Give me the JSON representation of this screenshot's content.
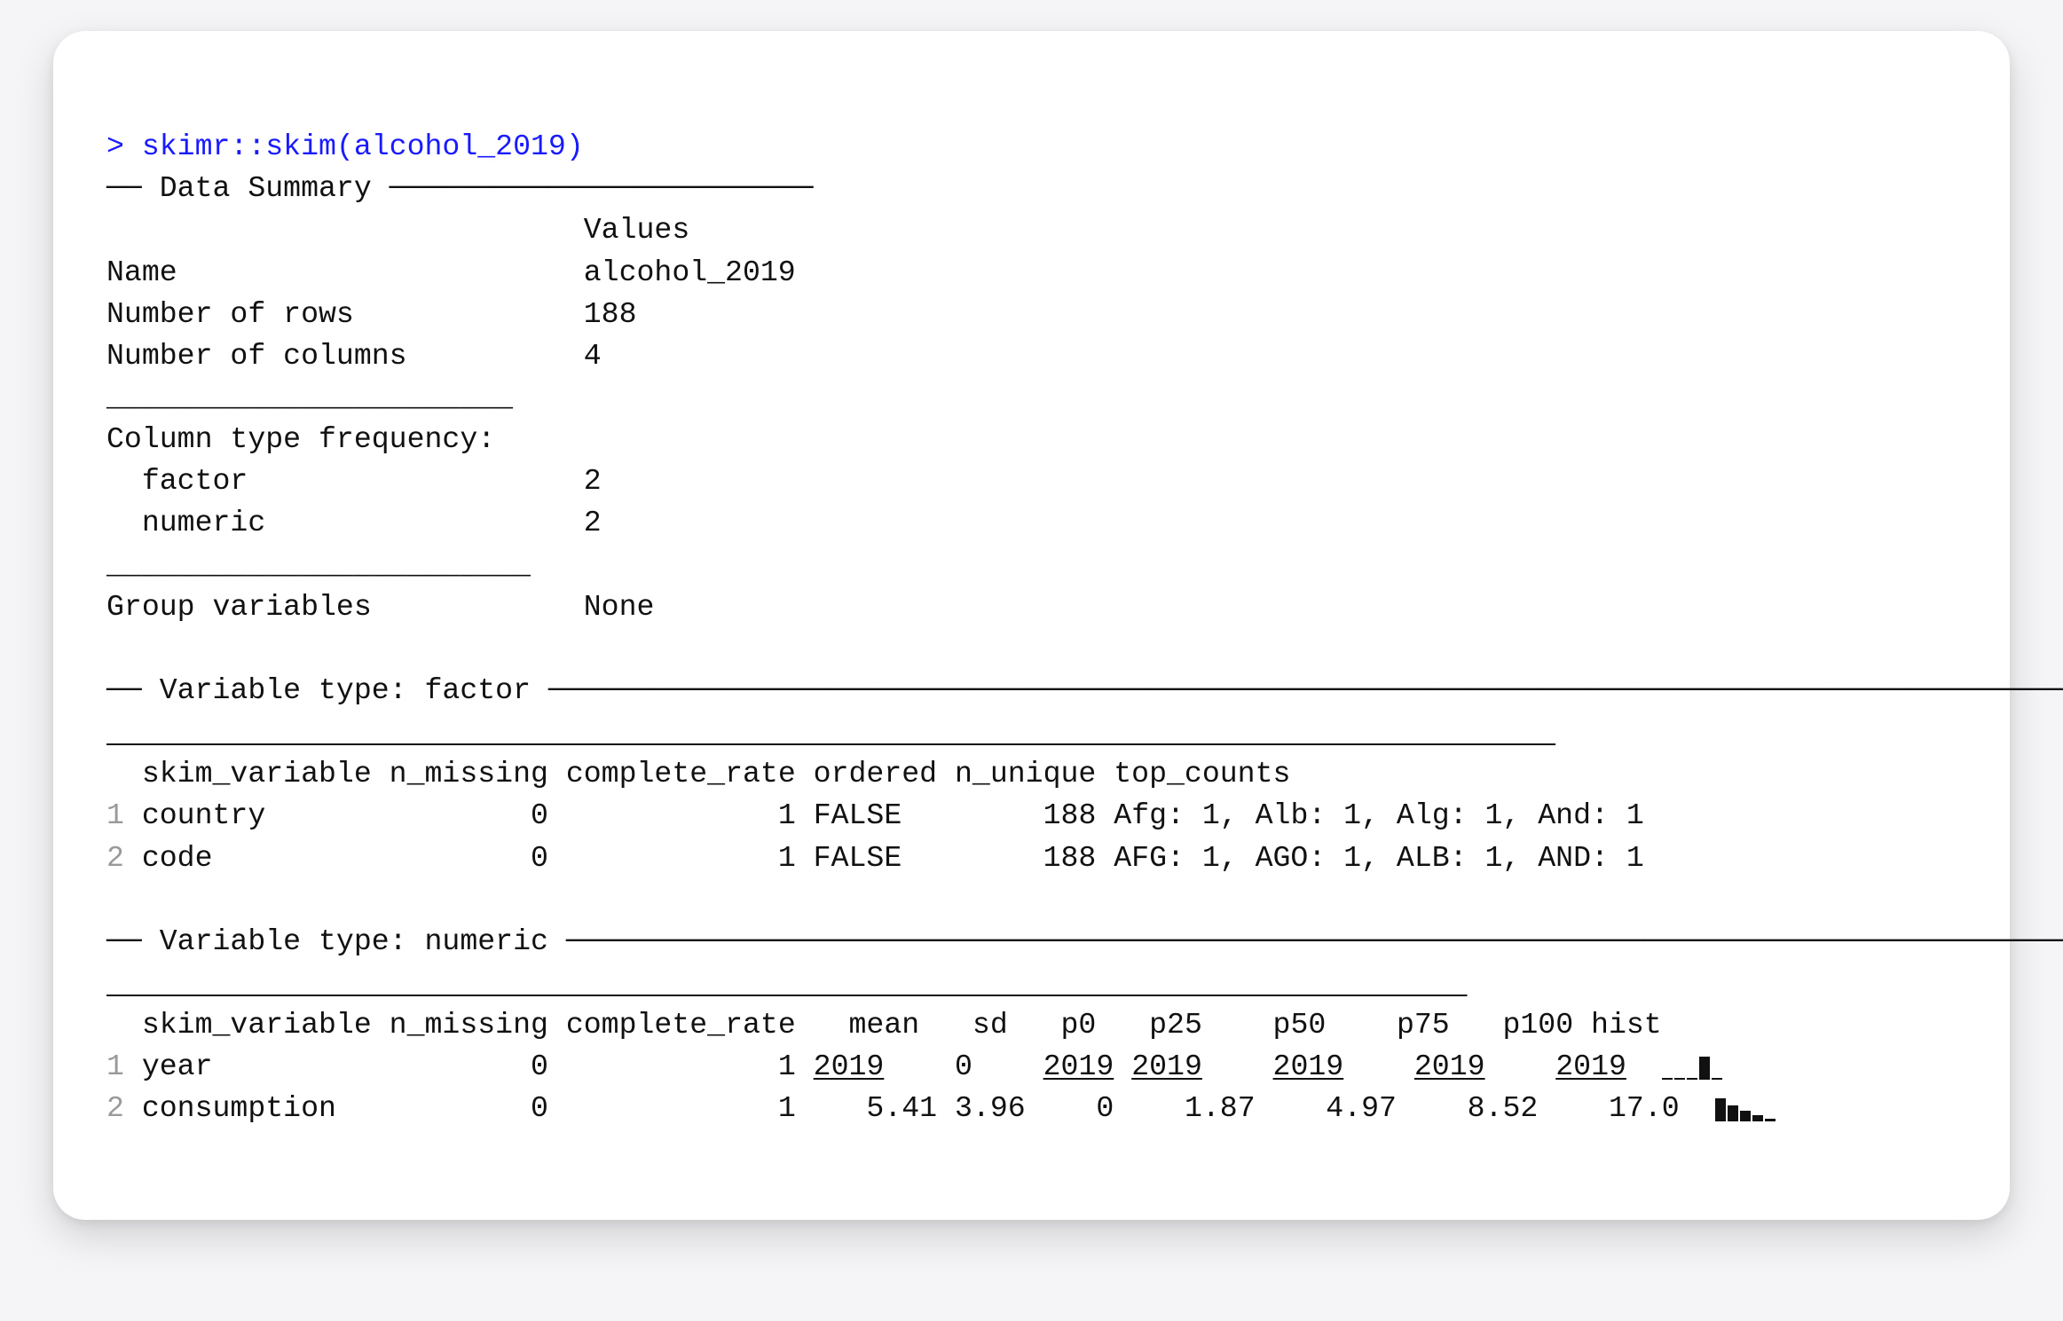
{
  "prompt_marker": ">",
  "command": "skimr::skim(alcohol_2019)",
  "summary_title": "Data Summary",
  "summary_values_header": "Values",
  "summary": {
    "name_label": "Name",
    "name_value": "alcohol_2019",
    "rows_label": "Number of rows",
    "rows_value": "188",
    "cols_label": "Number of columns",
    "cols_value": "4",
    "ctf_label": "Column type frequency:",
    "factor_label": "factor",
    "factor_value": "2",
    "numeric_label": "numeric",
    "numeric_value": "2",
    "group_label": "Group variables",
    "group_value": "None"
  },
  "factor_section_title": "Variable type: factor",
  "factor_headers": {
    "skim_variable": "skim_variable",
    "n_missing": "n_missing",
    "complete_rate": "complete_rate",
    "ordered": "ordered",
    "n_unique": "n_unique",
    "top_counts": "top_counts"
  },
  "factor_rows": [
    {
      "idx": "1",
      "skim_variable": "country",
      "n_missing": "0",
      "complete_rate": "1",
      "ordered": "FALSE",
      "n_unique": "188",
      "top_counts": "Afg: 1, Alb: 1, Alg: 1, And: 1"
    },
    {
      "idx": "2",
      "skim_variable": "code",
      "n_missing": "0",
      "complete_rate": "1",
      "ordered": "FALSE",
      "n_unique": "188",
      "top_counts": "AFG: 1, AGO: 1, ALB: 1, AND: 1"
    }
  ],
  "numeric_section_title": "Variable type: numeric",
  "numeric_headers": {
    "skim_variable": "skim_variable",
    "n_missing": "n_missing",
    "complete_rate": "complete_rate",
    "mean": "mean",
    "sd": "sd",
    "p0": "p0",
    "p25": "p25",
    "p50": "p50",
    "p75": "p75",
    "p100": "p100",
    "hist": "hist"
  },
  "numeric_rows": [
    {
      "idx": "1",
      "skim_variable": "year",
      "n_missing": "0",
      "complete_rate": "1",
      "mean": "2019",
      "sd": "0",
      "p0": "2019",
      "p25": "2019",
      "p50": "2019",
      "p75": "2019",
      "p100": "2019",
      "hist_svg": "year"
    },
    {
      "idx": "2",
      "skim_variable": "consumption",
      "n_missing": "0",
      "complete_rate": "1",
      "mean": "5.41",
      "sd": "3.96",
      "p0": "0",
      "p25": "1.87",
      "p50": "4.97",
      "p75": "8.52",
      "p100": "17.0",
      "hist_svg": "consumption"
    }
  ]
}
